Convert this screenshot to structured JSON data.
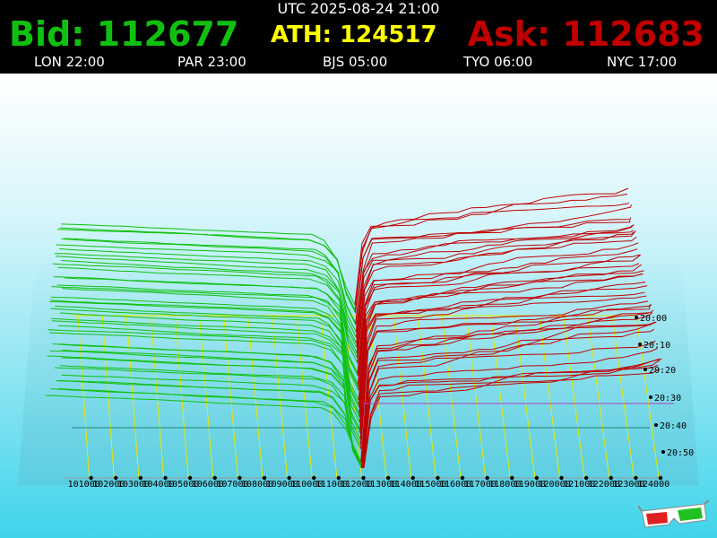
{
  "header": {
    "utc": "UTC 2025-08-24 21:00",
    "bid": "Bid: 112677",
    "ath": "ATH: 124517",
    "ask": "Ask: 112683",
    "cities": [
      "LON 22:00",
      "PAR 23:00",
      "BJS 05:00",
      "TYO 06:00",
      "NYC 17:00"
    ]
  },
  "colors": {
    "bid": "#10c010",
    "ask": "#c00000",
    "ath": "#ffff00",
    "grid": "#e8e800",
    "header_bg": "#000000"
  },
  "icons": {
    "glasses": "3d-glasses-icon"
  },
  "chart_data": {
    "type": "area",
    "x_ticks": [
      "101000",
      "102000",
      "103000",
      "104000",
      "105000",
      "106000",
      "107000",
      "108000",
      "109000",
      "110000",
      "111000",
      "112000",
      "113000",
      "114000",
      "115000",
      "116000",
      "117000",
      "118000",
      "119000",
      "120000",
      "121000",
      "122000",
      "123000",
      "124000"
    ],
    "y_ticks": [
      "20:00",
      "20:10",
      "20:20",
      "20:30",
      "20:40",
      "20:50"
    ],
    "xlim": [
      100000,
      124000
    ],
    "grid": true
  }
}
